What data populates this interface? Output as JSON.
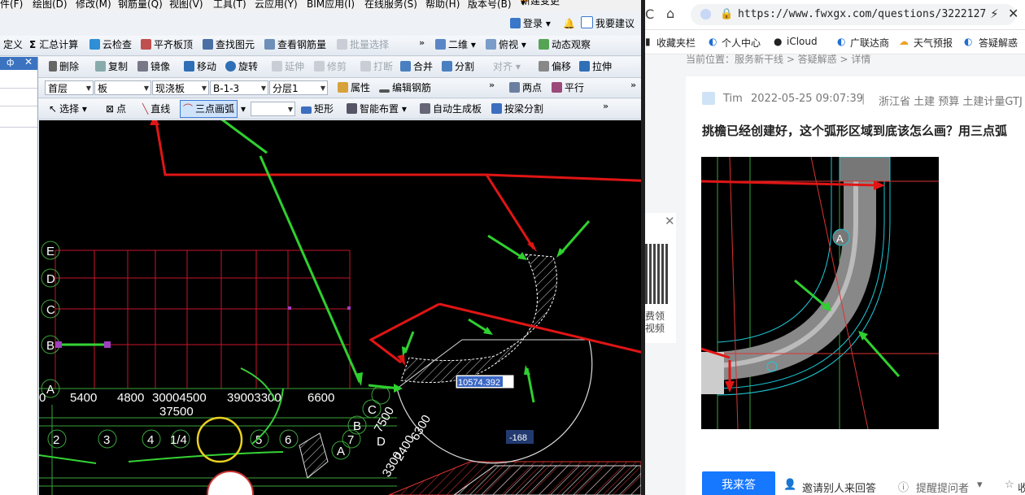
{
  "app": {
    "menu": [
      "件(F)",
      "绘图(D)",
      "修改(M)",
      "钢筋量(Q)",
      "视图(V)",
      "工具(T)",
      "云应用(Y)",
      "BIM应用(I)",
      "在线服务(S)",
      "帮助(H)",
      "版本号(B)",
      "新建变更"
    ],
    "top_right": {
      "login": "登录",
      "suggest": "我要建议"
    },
    "toolbar1": [
      "定义",
      "汇总计算",
      "云检查",
      "平齐板顶",
      "查找图元",
      "查看钢筋量",
      "批量选择",
      "二维",
      "俯视",
      "动态观察"
    ],
    "toolbar2": [
      "删除",
      "复制",
      "镜像",
      "移动",
      "旋转",
      "延伸",
      "修剪",
      "打断",
      "合并",
      "分割",
      "对齐",
      "偏移",
      "拉伸"
    ],
    "toolbar3": {
      "floor": "首层",
      "element_type": "板",
      "board_type": "现浇板",
      "board_id": "B-1-3",
      "layer": "分层1",
      "attr": "属性",
      "edit_rebar": "编辑钢筋",
      "two_points": "两点",
      "parallel": "平行"
    },
    "toolbar4": [
      "选择",
      "点",
      "直线",
      "三点画弧",
      "矩形",
      "智能布置",
      "自动生成板",
      "按梁分割"
    ],
    "panel_pin": "ф"
  },
  "cad": {
    "axis_letters": [
      "E",
      "D",
      "C",
      "B",
      "A"
    ],
    "axis_numbers": [
      "2",
      "3",
      "4",
      "1/4",
      "5",
      "6",
      "7",
      "8"
    ],
    "arc_letters": [
      "D",
      "C",
      "B",
      "A"
    ],
    "dims_row": [
      "0",
      "5400",
      "4800",
      "30004500",
      "39003300",
      "6600"
    ],
    "dim_total": "37500",
    "angled_dims": [
      "7500",
      "3300",
      "2400",
      "6300"
    ],
    "coord_input": "10574.392",
    "angle_label": "-168"
  },
  "browser": {
    "url": "https://www.fwxgx.com/questions/3222127",
    "bookmarks": [
      "收藏夹栏",
      "个人中心",
      "iCloud",
      "广联达商",
      "天气预报",
      "答疑解惑"
    ],
    "breadcrumb": "当前位置：服务新干线 > 答疑解惑 > 详情",
    "author": "Tim",
    "date": "2022-05-25 09:07:39",
    "meta": "浙江省  土建 预算 土建计量GTJ",
    "question": "挑檐已经创建好，这个弧形区域到底该怎么画？用三点弧",
    "qr_caption": "费领\n视频",
    "answer_btn": "我来答",
    "invite": "邀请别人来回答",
    "remind": "提醒提问者",
    "collect": "收"
  }
}
